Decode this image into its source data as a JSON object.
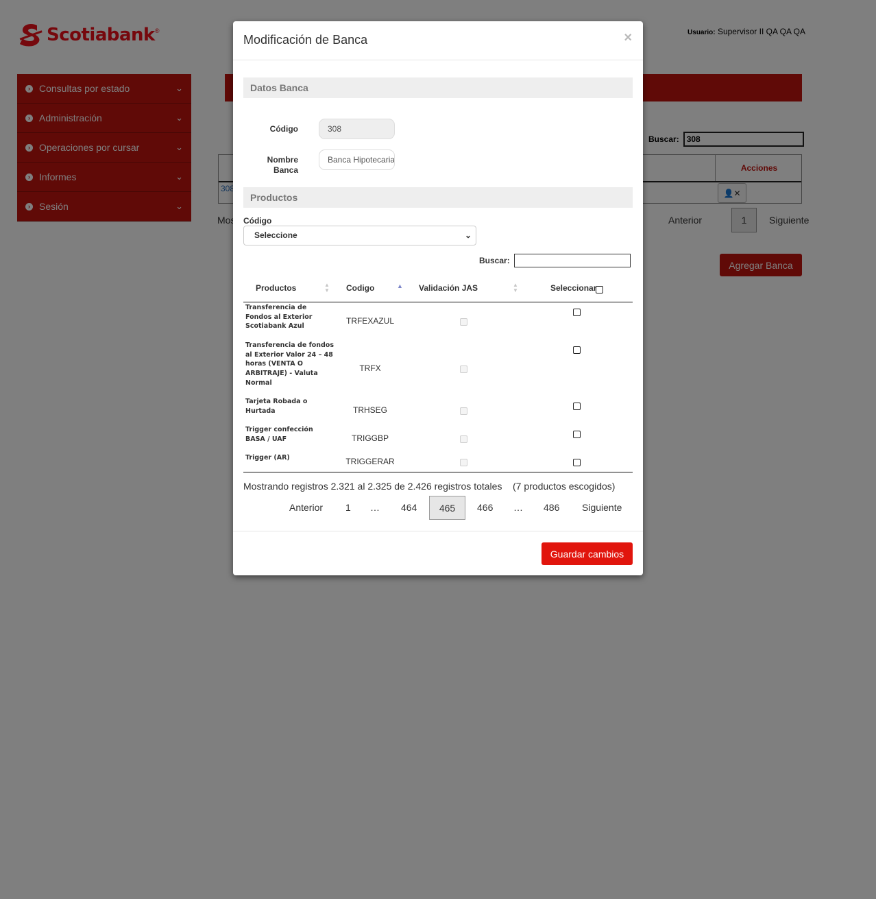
{
  "brand": {
    "name": "Scotiabank",
    "color": "#ec111a",
    "menu_color": "#c1140f"
  },
  "header": {
    "user_label": "Usuario:",
    "user_name": "Supervisor II QA QA QA"
  },
  "sidebar": {
    "items": [
      {
        "label": "Consultas por estado",
        "icon": "circle-chevron-right-icon"
      },
      {
        "label": "Administración",
        "icon": "circle-chevron-right-icon"
      },
      {
        "label": "Operaciones por cursar",
        "icon": "circle-chevron-right-icon"
      },
      {
        "label": "Informes",
        "icon": "circle-chevron-right-icon"
      },
      {
        "label": "Sesión",
        "icon": "circle-chevron-right-icon"
      }
    ]
  },
  "background": {
    "search_label": "Buscar:",
    "search_value": "308",
    "actions_header": "Acciones",
    "row_code": "308",
    "info_prefix": "Mos",
    "prev": "Anterior",
    "page": "1",
    "next": "Siguiente",
    "add_button": "Agregar Banca"
  },
  "modal": {
    "title": "Modificación de Banca",
    "close": "×",
    "datos_title": "Datos Banca",
    "code_label": "Código",
    "code_value": "308",
    "name_label_1": "Nombre",
    "name_label_2": "Banca",
    "name_value": "Banca Hipotecaria",
    "productos_title": "Productos",
    "select_label": "Código",
    "select_value": "Seleccione",
    "search_label": "Buscar:",
    "columns": [
      "Productos",
      "Codigo",
      "Validación JAS",
      "Seleccionar"
    ],
    "rows": [
      {
        "product": "Transferencia de Fondos al Exterior Scotiabank Azul",
        "code": "TRFEXAZUL"
      },
      {
        "product": "Transferencia de fondos al Exterior Valor 24 – 48 horas (VENTA O ARBITRAJE) - Valuta Normal",
        "code": "TRFX"
      },
      {
        "product": "Tarjeta Robada o Hurtada",
        "code": "TRHSEG"
      },
      {
        "product": "Trigger confección BASA / UAF",
        "code": "TRIGGBP"
      },
      {
        "product": "Trigger (AR)",
        "code": "TRIGGERAR"
      }
    ],
    "info": "Mostrando registros 2.321 al 2.325 de 2.426 registros totales",
    "chosen": "(7 productos escogidos)",
    "pagination": {
      "prev": "Anterior",
      "p1": "1",
      "ellipsis1": "…",
      "p464": "464",
      "current": "465",
      "p466": "466",
      "ellipsis2": "…",
      "last": "486",
      "next": "Siguiente"
    },
    "save_button": "Guardar cambios"
  }
}
